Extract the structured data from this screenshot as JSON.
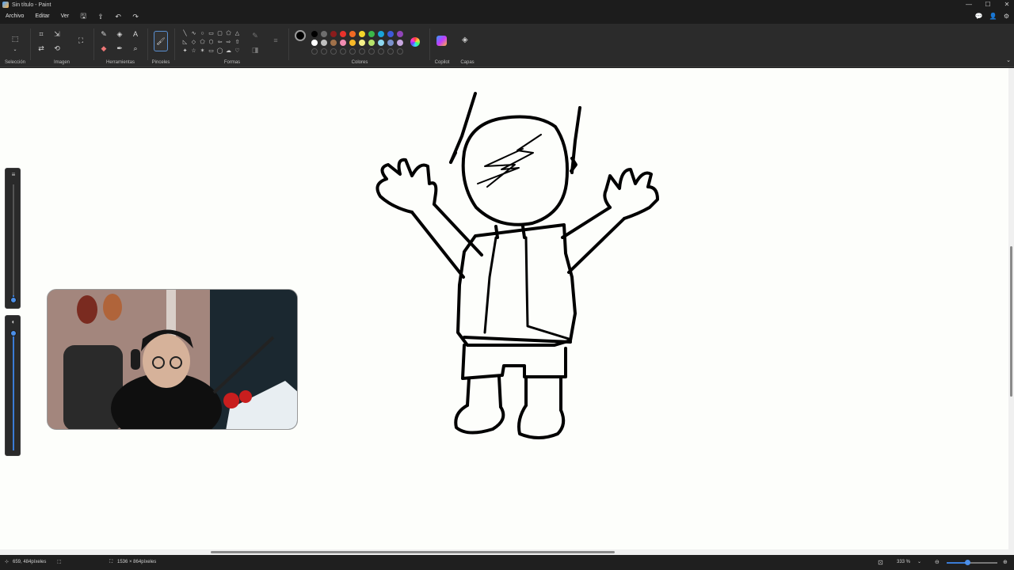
{
  "window": {
    "title": "Sin título - Paint",
    "controls": [
      "—",
      "☐",
      "✕"
    ]
  },
  "menu": {
    "items": [
      "Archivo",
      "Editar",
      "Ver"
    ]
  },
  "ribbon": {
    "groups": {
      "seleccion": "Selección",
      "imagen": "Imagen",
      "herramientas": "Herramientas",
      "pinceles": "Pinceles",
      "formas": "Formas",
      "colores": "Colores",
      "copilot": "Copilot",
      "capas": "Capas"
    },
    "current_color": "#000000",
    "secondary_color": "#ffffff",
    "palette_row1": [
      "#000000",
      "#6e6e6e",
      "#8b1c1c",
      "#e8322c",
      "#f06a24",
      "#f5d52b",
      "#3bb84a",
      "#19a4d8",
      "#3d5ad8",
      "#9045b8"
    ],
    "palette_row2": [
      "#ffffff",
      "#bfbfbf",
      "#a0714a",
      "#f28db2",
      "#f7b928",
      "#f4f08a",
      "#b7e36b",
      "#8fd8f0",
      "#7b92cc",
      "#c8a8e0"
    ]
  },
  "status": {
    "cursor_position": "659, 484píxeles",
    "canvas_size": "1536 × 864píxeles",
    "zoom": "333 %",
    "zoom_fraction": 0.4
  }
}
